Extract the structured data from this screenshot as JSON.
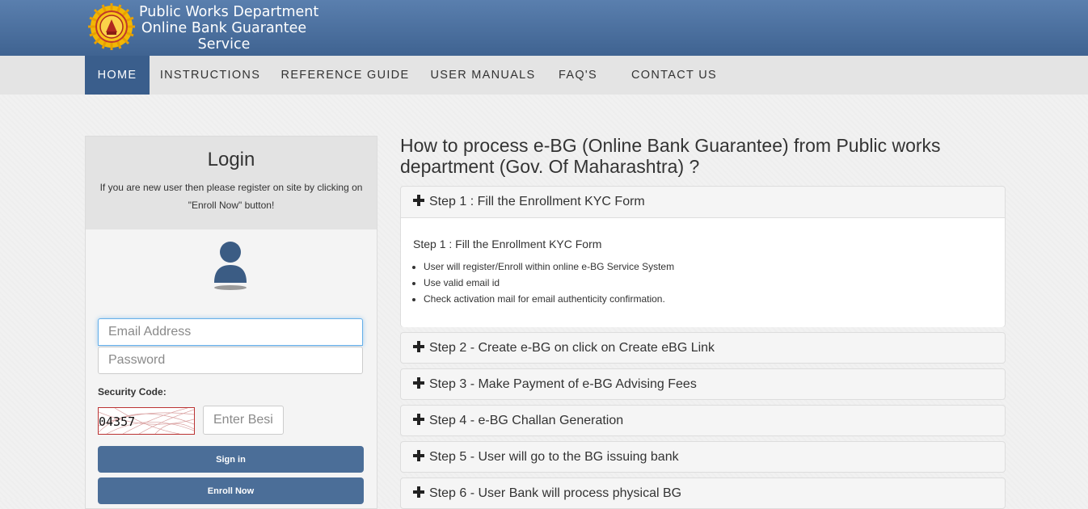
{
  "header": {
    "title_lines": [
      "Public Works Department",
      "Online Bank Guarantee",
      "Service"
    ],
    "logo_icon": "government-seal-icon",
    "colors": {
      "header_top": "#5a7fae",
      "header_bottom": "#3f6391",
      "active_nav": "#3a5e8c"
    }
  },
  "nav": {
    "items": [
      {
        "label": "HOME",
        "active": true
      },
      {
        "label": "INSTRUCTIONS"
      },
      {
        "label": "REFERENCE GUIDE"
      },
      {
        "label": "USER MANUALS"
      },
      {
        "label": "FAQ'S"
      },
      {
        "label": "CONTACT US"
      }
    ]
  },
  "login": {
    "title": "Login",
    "subtitle": "If you are new user then please register on site by clicking on \"Enroll Now\" button!",
    "avatar_icon": "user-icon",
    "email_placeholder": "Email Address",
    "password_placeholder": "Password",
    "security_label": "Security Code:",
    "captcha_text": "04357",
    "captcha_placeholder": "Enter Besi",
    "signin_label": "Sign in",
    "enroll_label": "Enroll Now"
  },
  "main": {
    "title": "How to process e-BG (Online Bank Guarantee) from Public works department (Gov. Of Maharashtra) ?",
    "steps": [
      {
        "label": "Step 1 : Fill the Enrollment KYC Form",
        "expanded": true,
        "body_title": "Step 1 : Fill the Enrollment KYC Form",
        "bullets": [
          "User will register/Enroll within online e-BG Service System",
          "Use valid email id",
          "Check activation mail for email authenticity confirmation."
        ]
      },
      {
        "label": "Step 2 - Create e-BG on click on Create eBG Link"
      },
      {
        "label": "Step 3 - Make Payment of e-BG Advising Fees"
      },
      {
        "label": "Step 4 - e-BG Challan Generation"
      },
      {
        "label": "Step 5 - User will go to the BG issuing bank"
      },
      {
        "label": "Step 6 - User Bank will process physical BG"
      }
    ]
  }
}
